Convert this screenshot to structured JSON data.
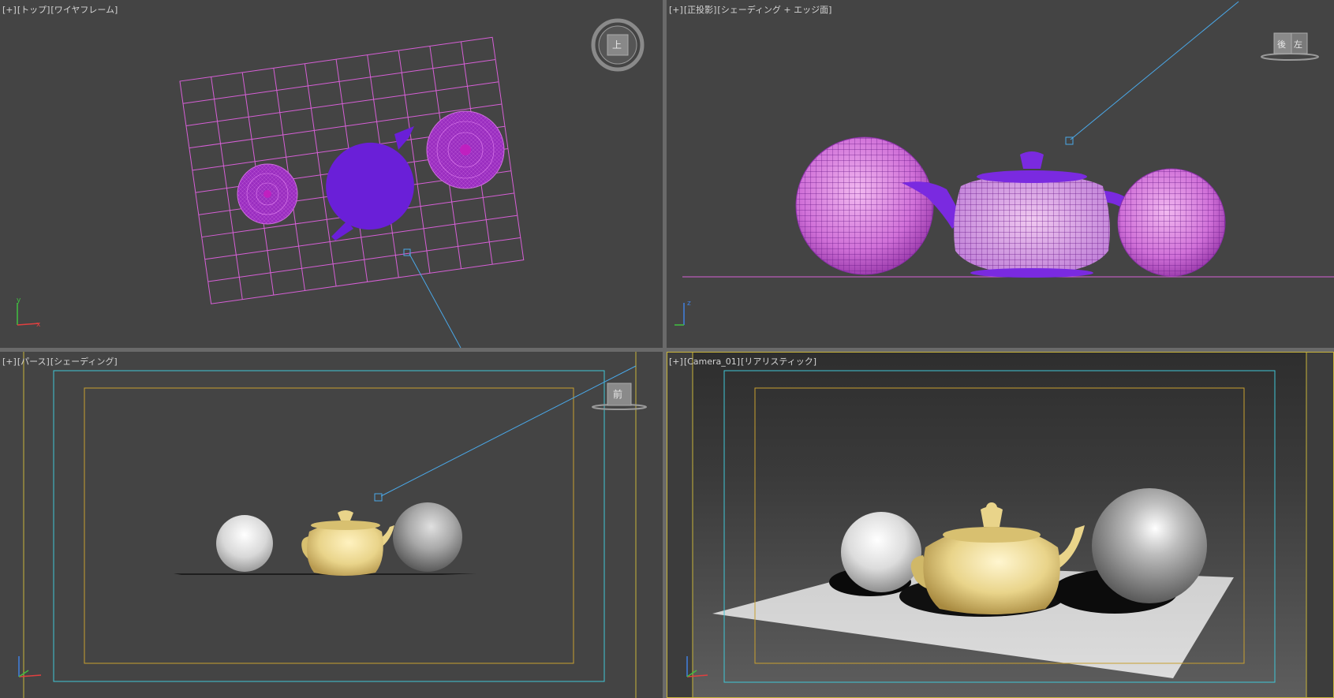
{
  "viewports": {
    "top": {
      "label": [
        "[+]",
        "[トップ]",
        "[ワイヤフレーム]"
      ],
      "navcube": "上"
    },
    "front": {
      "label": [
        "[+]",
        "[正投影]",
        "[シェーディング + エッジ面]"
      ],
      "navcube": [
        "後",
        "左"
      ]
    },
    "persp": {
      "label": [
        "[+]",
        "[パース]",
        "[シェーディング]"
      ],
      "navcube": "前"
    },
    "camera": {
      "label": [
        "[+]",
        "[Camera_01]",
        "[リアリスティック]"
      ]
    }
  },
  "axis_letters": {
    "x": "x",
    "y": "y",
    "z": "z"
  },
  "colors": {
    "viewport_bg": "#444444",
    "wire_pink": "#d65fd6",
    "teapot_purple": "#6a1fd8",
    "teapot_yellow": "#e9d48a",
    "safe_frame_cyan": "#3fc6d6",
    "safe_frame_yellow": "#c8a030",
    "camera_line": "#4aa8e8"
  }
}
